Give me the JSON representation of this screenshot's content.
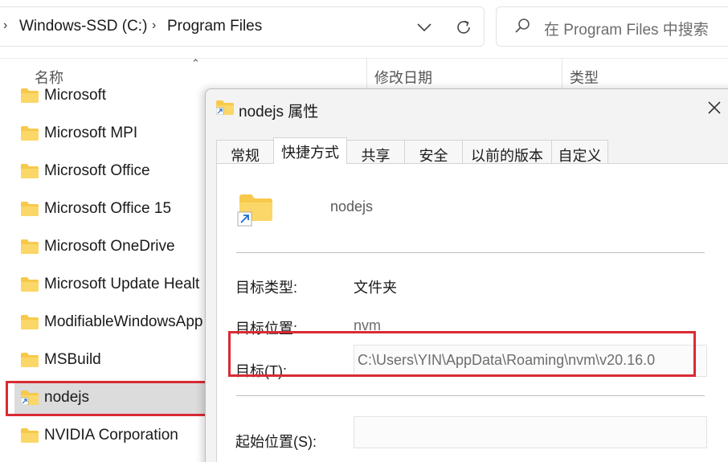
{
  "address_bar": {
    "breadcrumbs": [
      "Windows-SSD (C:)",
      "Program Files"
    ]
  },
  "search": {
    "placeholder": "在 Program Files 中搜索"
  },
  "columns": {
    "name": "名称",
    "modified": "修改日期",
    "type": "类型"
  },
  "files": [
    {
      "name": "Microsoft",
      "shortcut": false
    },
    {
      "name": "Microsoft MPI",
      "shortcut": false
    },
    {
      "name": "Microsoft Office",
      "shortcut": false
    },
    {
      "name": "Microsoft Office 15",
      "shortcut": false
    },
    {
      "name": "Microsoft OneDrive",
      "shortcut": false
    },
    {
      "name": "Microsoft Update Healt",
      "shortcut": false
    },
    {
      "name": "ModifiableWindowsApp",
      "shortcut": false
    },
    {
      "name": "MSBuild",
      "shortcut": false
    },
    {
      "name": "nodejs",
      "shortcut": true,
      "selected": true
    },
    {
      "name": "NVIDIA Corporation",
      "shortcut": false
    }
  ],
  "dialog": {
    "title": "nodejs 属性",
    "tabs": [
      "常规",
      "快捷方式",
      "共享",
      "安全",
      "以前的版本",
      "自定义"
    ],
    "active_tab": "快捷方式",
    "shortcut_name": "nodejs",
    "target_type_label": "目标类型:",
    "target_type_value": "文件夹",
    "target_location_label": "目标位置:",
    "target_location_value": "nvm",
    "target_label": "目标(T):",
    "target_value": "C:\\Users\\YIN\\AppData\\Roaming\\nvm\\v20.16.0",
    "start_in_label": "起始位置(S):",
    "start_in_value": ""
  },
  "colors": {
    "highlight": "#d92b34",
    "folder": "#f7c94b",
    "shortcut_arrow": "#1a6fc9",
    "selected_row": "#dcdcdc"
  }
}
